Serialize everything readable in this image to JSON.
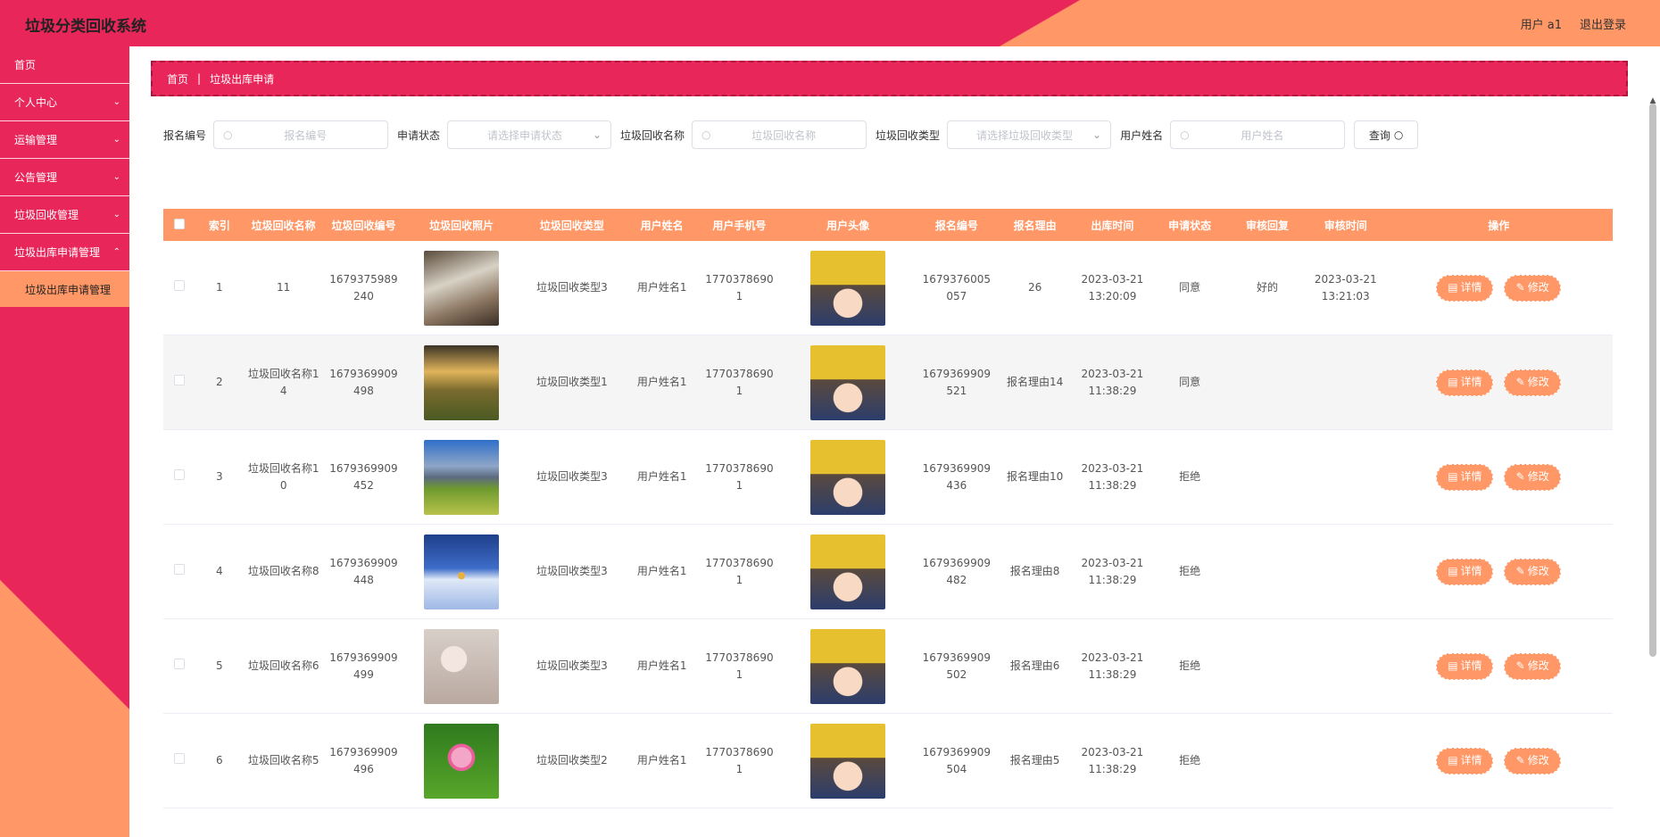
{
  "header": {
    "title": "垃圾分类回收系统",
    "user": "用户 a1",
    "logout": "退出登录"
  },
  "sidebar": {
    "items": [
      {
        "label": "首页",
        "chevron": false
      },
      {
        "label": "个人中心",
        "chevron": true
      },
      {
        "label": "运输管理",
        "chevron": true
      },
      {
        "label": "公告管理",
        "chevron": true
      },
      {
        "label": "垃圾回收管理",
        "chevron": true
      },
      {
        "label": "垃圾出库申请管理",
        "chevron": true
      }
    ],
    "submenu": "垃圾出库申请管理"
  },
  "breadcrumb": {
    "home": "首页",
    "current": "垃圾出库申请"
  },
  "filters": {
    "f1": {
      "label": "报名编号",
      "placeholder": "报名编号"
    },
    "f2": {
      "label": "申请状态",
      "placeholder": "请选择申请状态"
    },
    "f3": {
      "label": "垃圾回收名称",
      "placeholder": "垃圾回收名称"
    },
    "f4": {
      "label": "垃圾回收类型",
      "placeholder": "请选择垃圾回收类型"
    },
    "f5": {
      "label": "用户姓名",
      "placeholder": "用户姓名"
    },
    "search": "查询"
  },
  "table": {
    "headers": [
      "",
      "索引",
      "垃圾回收名称",
      "垃圾回收编号",
      "垃圾回收照片",
      "垃圾回收类型",
      "用户姓名",
      "用户手机号",
      "用户头像",
      "报名编号",
      "报名理由",
      "出库时间",
      "申请状态",
      "审核回复",
      "审核时间",
      "操作"
    ],
    "detail_label": "详情",
    "edit_label": "修改",
    "rows": [
      {
        "index": "1",
        "name": "11",
        "code": "1679375989240",
        "photo": "waterfall",
        "type": "垃圾回收类型3",
        "user": "用户姓名1",
        "phone": "17703786901",
        "enroll_no": "1679376005057",
        "reason": "26",
        "out_time": "2023-03-21 13:20:09",
        "status": "同意",
        "reply": "好的",
        "review_time": "2023-03-21 13:21:03"
      },
      {
        "index": "2",
        "name": "垃圾回收名称14",
        "code": "1679369909498",
        "photo": "sunset-hills",
        "type": "垃圾回收类型1",
        "user": "用户姓名1",
        "phone": "17703786901",
        "enroll_no": "1679369909521",
        "reason": "报名理由14",
        "out_time": "2023-03-21 11:38:29",
        "status": "同意",
        "reply": "",
        "review_time": ""
      },
      {
        "index": "3",
        "name": "垃圾回收名称10",
        "code": "1679369909452",
        "photo": "mountain-meadow",
        "type": "垃圾回收类型3",
        "user": "用户姓名1",
        "phone": "17703786901",
        "enroll_no": "1679369909436",
        "reason": "报名理由10",
        "out_time": "2023-03-21 11:38:29",
        "status": "拒绝",
        "reply": "",
        "review_time": ""
      },
      {
        "index": "4",
        "name": "垃圾回收名称8",
        "code": "1679369909448",
        "photo": "snow-house",
        "type": "垃圾回收类型3",
        "user": "用户姓名1",
        "phone": "17703786901",
        "enroll_no": "1679369909482",
        "reason": "报名理由8",
        "out_time": "2023-03-21 11:38:29",
        "status": "拒绝",
        "reply": "",
        "review_time": ""
      },
      {
        "index": "5",
        "name": "垃圾回收名称6",
        "code": "1679369909499",
        "photo": "blossom-branch",
        "type": "垃圾回收类型3",
        "user": "用户姓名1",
        "phone": "17703786901",
        "enroll_no": "1679369909502",
        "reason": "报名理由6",
        "out_time": "2023-03-21 11:38:29",
        "status": "拒绝",
        "reply": "",
        "review_time": ""
      },
      {
        "index": "6",
        "name": "垃圾回收名称5",
        "code": "1679369909496",
        "photo": "lotus",
        "type": "垃圾回收类型2",
        "user": "用户姓名1",
        "phone": "17703786901",
        "enroll_no": "1679369909504",
        "reason": "报名理由5",
        "out_time": "2023-03-21 11:38:29",
        "status": "拒绝",
        "reply": "",
        "review_time": ""
      }
    ]
  }
}
